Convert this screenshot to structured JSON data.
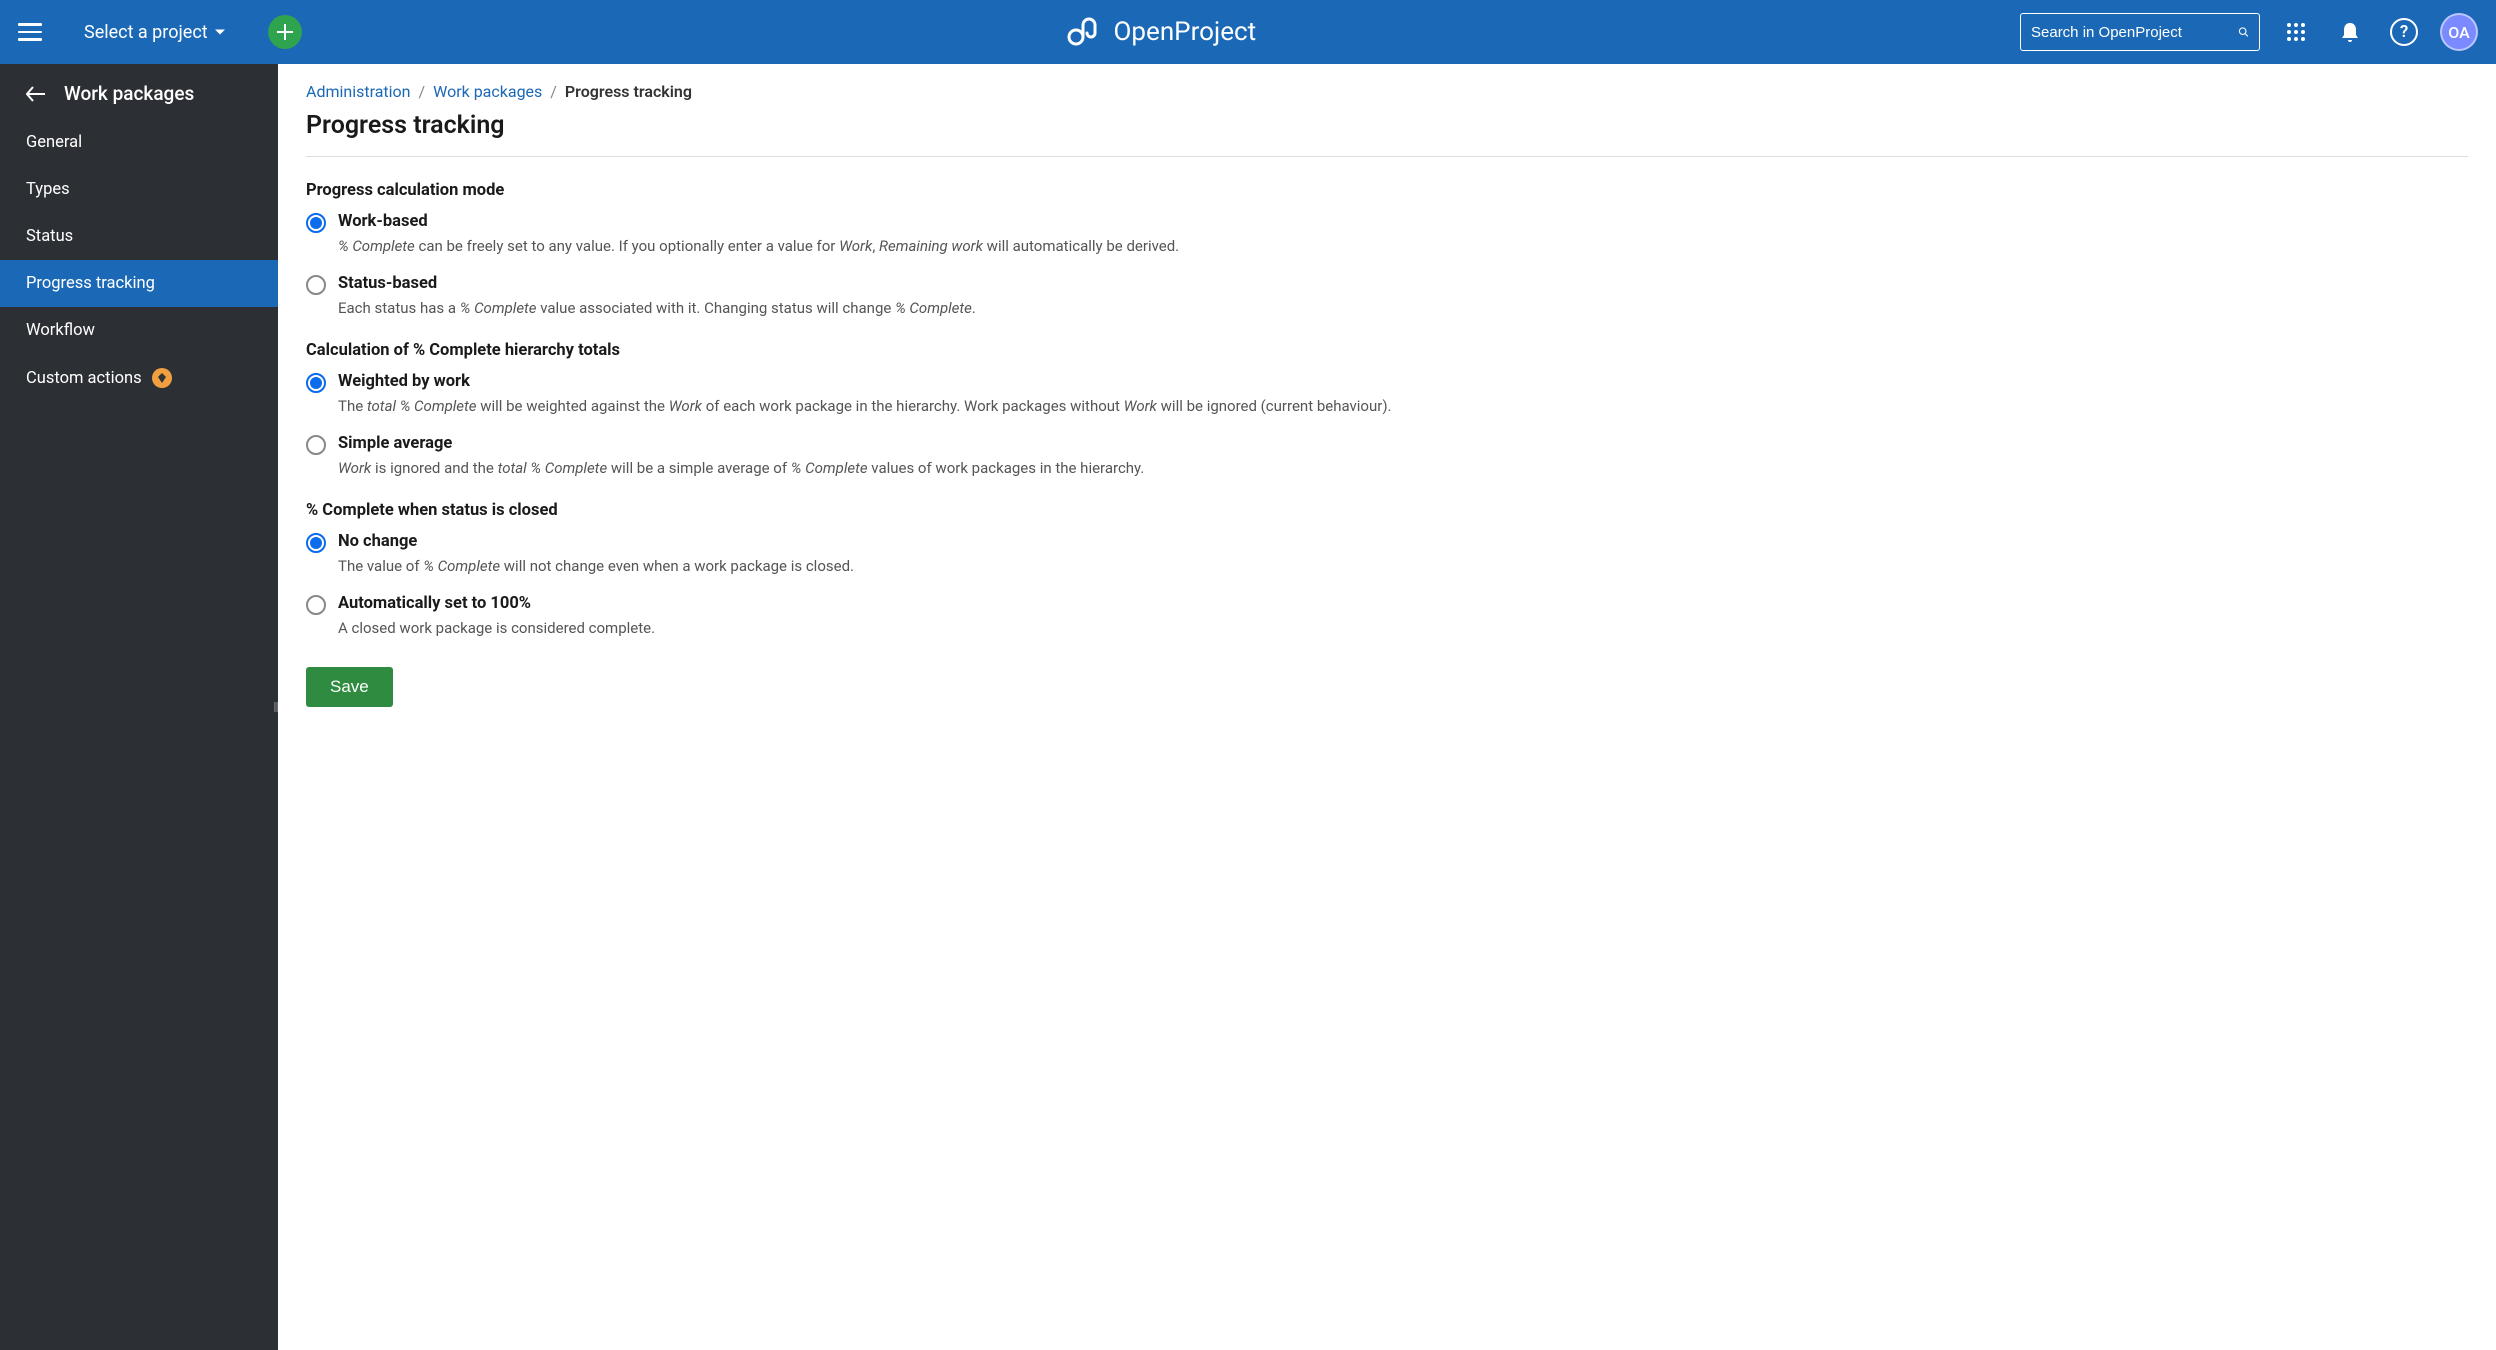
{
  "header": {
    "project_selector": "Select a project",
    "brand": "OpenProject",
    "search_placeholder": "Search in OpenProject",
    "avatar_initials": "OA"
  },
  "sidebar": {
    "title": "Work packages",
    "items": [
      {
        "label": "General",
        "active": false
      },
      {
        "label": "Types",
        "active": false
      },
      {
        "label": "Status",
        "active": false
      },
      {
        "label": "Progress tracking",
        "active": true
      },
      {
        "label": "Workflow",
        "active": false
      },
      {
        "label": "Custom actions",
        "active": false,
        "ee": true
      }
    ]
  },
  "breadcrumb": {
    "items": [
      {
        "label": "Administration",
        "link": true
      },
      {
        "label": "Work packages",
        "link": true
      },
      {
        "label": "Progress tracking",
        "link": false
      }
    ]
  },
  "page": {
    "title": "Progress tracking",
    "section1_label": "Progress calculation mode",
    "section1_options": [
      {
        "title": "Work-based",
        "selected": true,
        "desc_html": "<em>% Complete</em> can be freely set to any value. If you optionally enter a value for <em>Work</em>, <em>Remaining work</em> will automatically be derived."
      },
      {
        "title": "Status-based",
        "selected": false,
        "desc_html": "Each status has a <em>% Complete</em> value associated with it. Changing status will change <em>% Complete</em>."
      }
    ],
    "section2_label": "Calculation of % Complete hierarchy totals",
    "section2_options": [
      {
        "title": "Weighted by work",
        "selected": true,
        "desc_html": "The <em>total % Complete</em> will be weighted against the <em>Work</em> of each work package in the hierarchy. Work packages without <em>Work</em> will be ignored (current behaviour)."
      },
      {
        "title": "Simple average",
        "selected": false,
        "desc_html": "<em>Work</em> is ignored and the <em>total % Complete</em> will be a simple average of <em>% Complete</em> values of work packages in the hierarchy."
      }
    ],
    "section3_label": "% Complete when status is closed",
    "section3_options": [
      {
        "title": "No change",
        "selected": true,
        "desc_html": "The value of <em>% Complete</em> will not change even when a work package is closed."
      },
      {
        "title": "Automatically set to 100%",
        "selected": false,
        "desc_html": "A closed work package is considered complete."
      }
    ],
    "save_label": "Save"
  }
}
